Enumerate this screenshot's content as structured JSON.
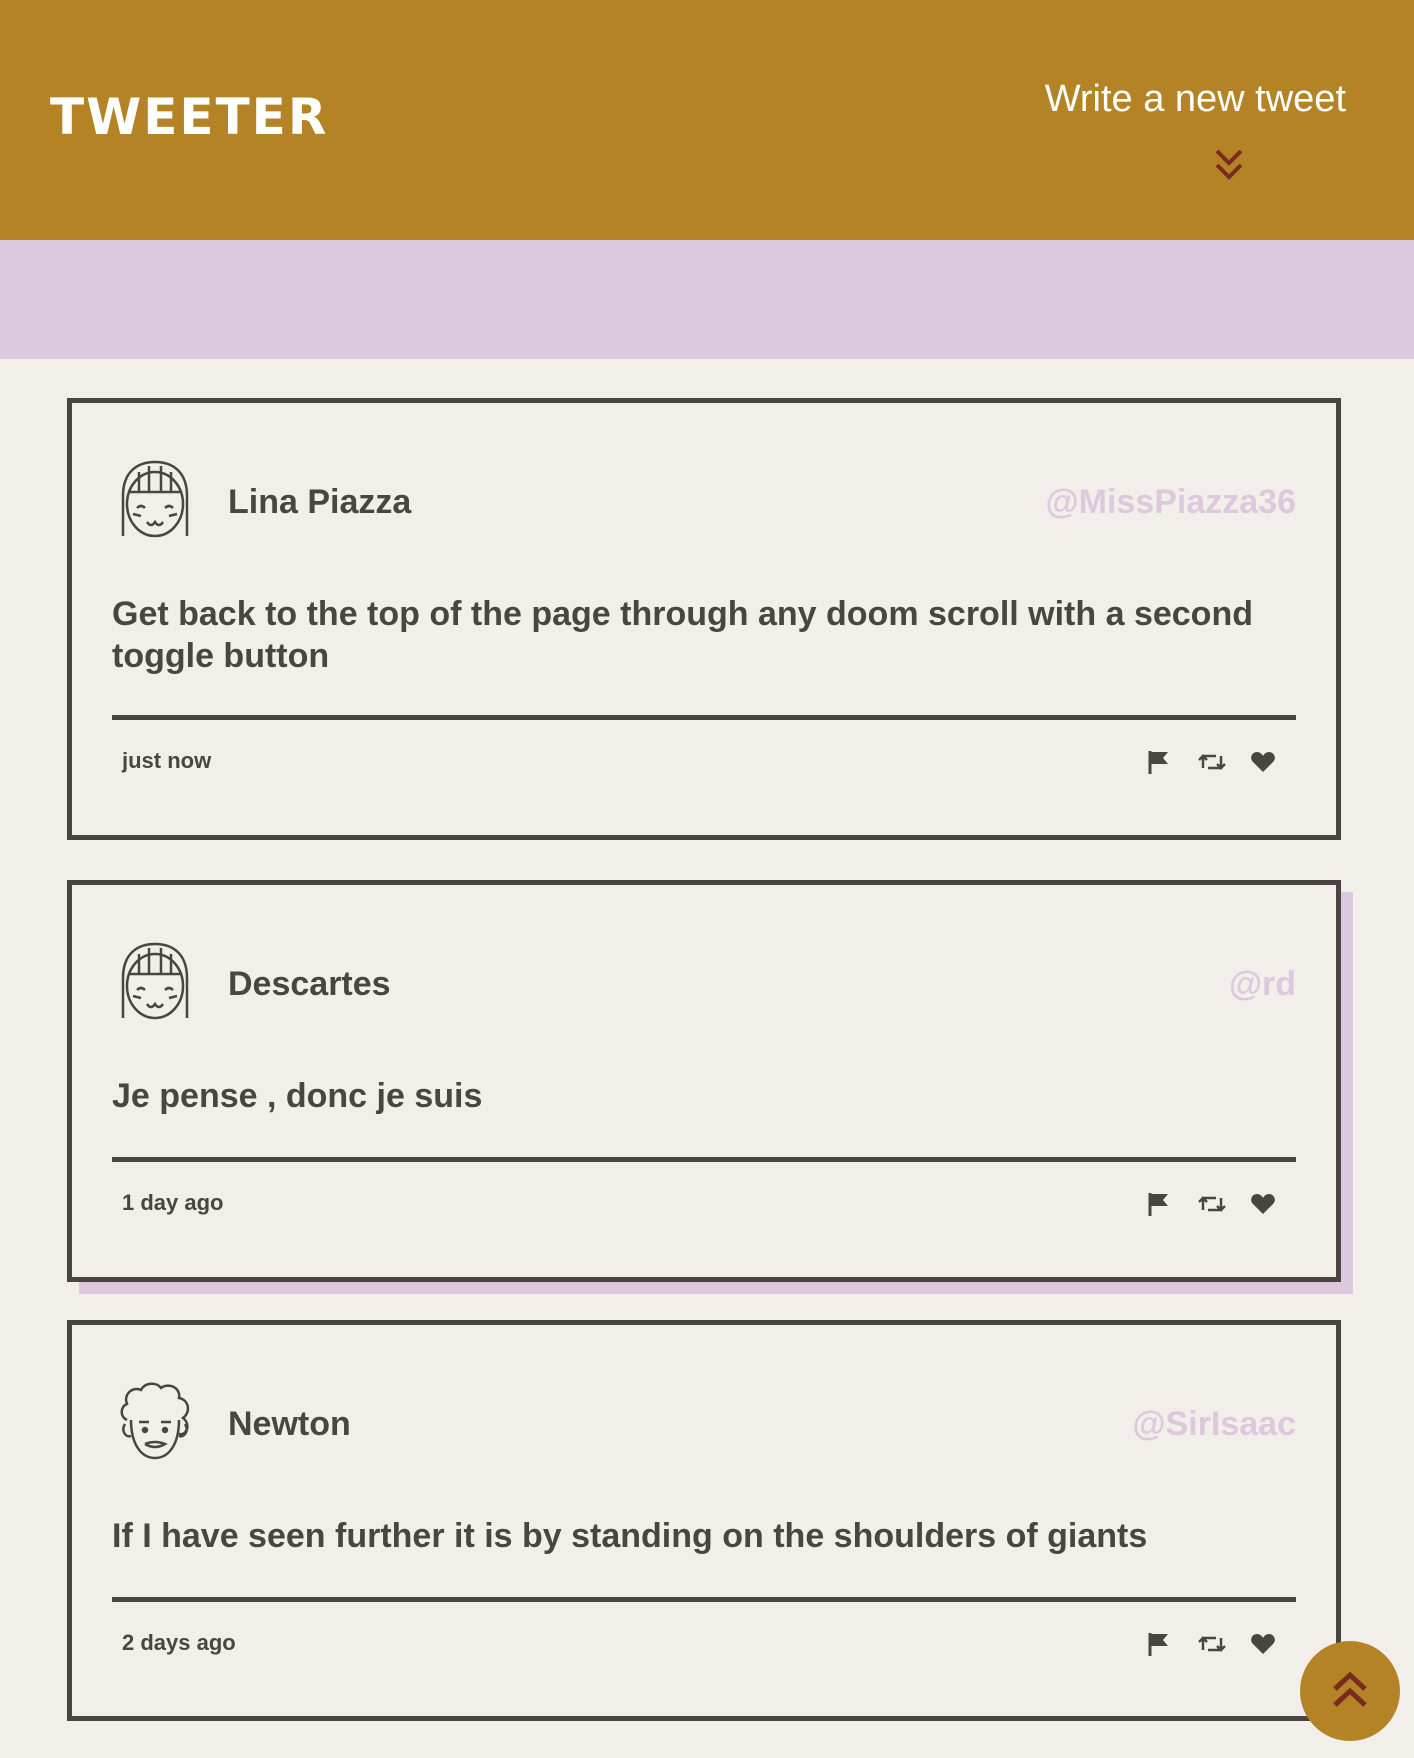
{
  "nav": {
    "brand": "TWEETER",
    "compose_label": "Write a new tweet",
    "compose_icon": "double-chevron-down-icon"
  },
  "colors": {
    "header_bg": "#b38326",
    "compose_area_bg": "#ddc9de",
    "page_bg": "#f2efeb",
    "text": "#4a4541",
    "handle": "#ddc9de",
    "accent_icon": "#7a2a1f"
  },
  "tweets": [
    {
      "name": "Lina Piazza",
      "handle": "@MissPiazza36",
      "content": "Get back to the top of the page through any doom scroll with a second toggle button",
      "time": "just now",
      "avatar_icon": "girl-avatar-icon"
    },
    {
      "name": "Descartes",
      "handle": "@rd",
      "content": "Je pense , donc je suis",
      "time": "1 day ago",
      "avatar_icon": "girl-avatar-icon"
    },
    {
      "name": "Newton",
      "handle": "@SirIsaac",
      "content": "If I have seen further it is by standing on the shoulders of giants",
      "time": "2 days ago",
      "avatar_icon": "curly-hair-avatar-icon"
    }
  ],
  "actions": [
    "flag-icon",
    "retweet-icon",
    "heart-icon"
  ],
  "scroll_top_icon": "double-chevron-up-icon"
}
